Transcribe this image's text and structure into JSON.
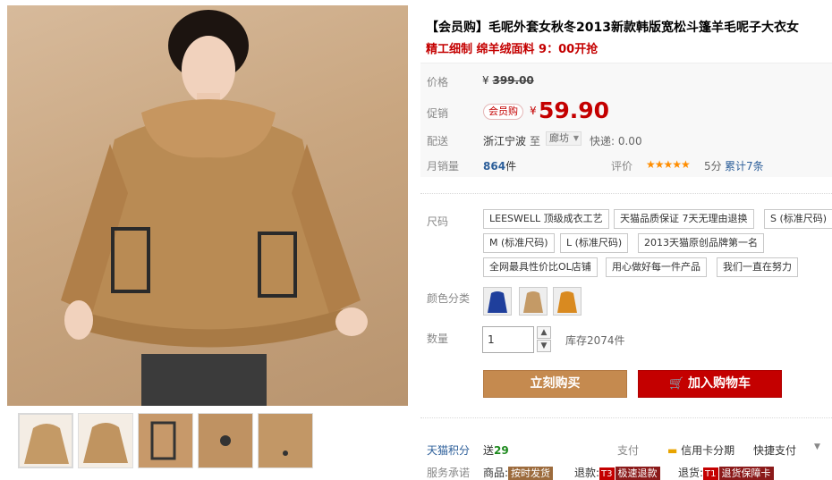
{
  "product": {
    "title": "【会员购】毛呢外套女秋冬2013新款韩版宽松斗篷羊毛呢子大衣女",
    "subtitle": "精工细制 绵羊绒面料 9：00开抢"
  },
  "price": {
    "label": "价格",
    "currency": "¥",
    "original": "399.00",
    "promo_label": "促销",
    "promo_badge": "会员购",
    "promo_price": "59.90"
  },
  "shipping": {
    "label": "配送",
    "from": "浙江宁波",
    "to_word": "至",
    "to_city": "廊坊",
    "express": "快递: 0.00"
  },
  "sales": {
    "label": "月销量",
    "count": "864",
    "unit": "件",
    "rating_label": "评价",
    "stars": "★★★★★",
    "rating_score": "5分",
    "reviews_link": "累计7条"
  },
  "size": {
    "label": "尺码",
    "options": [
      "LEESWELL 顶级成衣工艺",
      "天猫品质保证 7天无理由退换",
      "S (标准尺码)",
      "M (标准尺码)",
      "L (标准尺码)",
      "2013天猫原创品牌第一名",
      "全网最具性价比OL店铺",
      "用心做好每一件产品",
      "我们一直在努力"
    ]
  },
  "color": {
    "label": "颜色分类",
    "swatches": [
      "blue",
      "camel",
      "orange"
    ],
    "swatch_colors": [
      "#1f3f9c",
      "#c49a66",
      "#d98a20"
    ]
  },
  "quantity": {
    "label": "数量",
    "value": "1",
    "stock": "库存2074件"
  },
  "actions": {
    "buy": "立刻购买",
    "cart": "加入购物车"
  },
  "points": {
    "label": "天猫积分",
    "send": "送",
    "value": "29",
    "pay_label": "支付",
    "credit": "信用卡分期",
    "quick": "快捷支付"
  },
  "service": {
    "label": "服务承诺",
    "goods": "商品:",
    "goods_tag": "按时发货",
    "refund": "退款:",
    "refund_code": "T3",
    "refund_tag": "极速退款",
    "return": "退货:",
    "return_code": "T1",
    "return_tag": "退货保障卡"
  },
  "icons": {
    "cart": "cart-icon",
    "credit_card": "credit-card-icon",
    "dropdown": "chevron-down-icon",
    "stars": "star-icon"
  }
}
